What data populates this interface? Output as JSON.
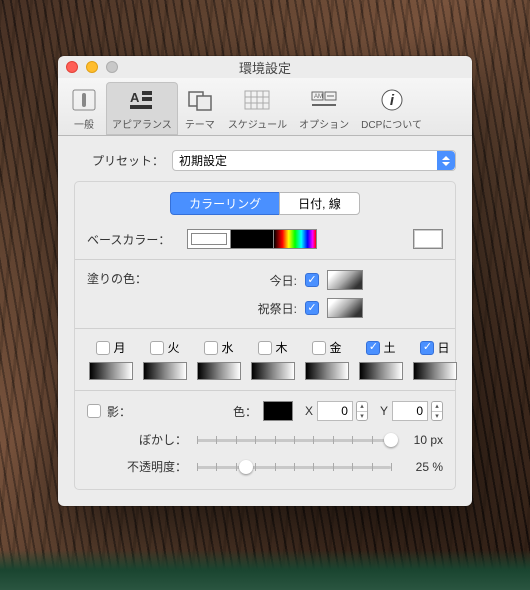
{
  "window": {
    "title": "環境設定"
  },
  "toolbar": {
    "items": [
      {
        "label": "一般"
      },
      {
        "label": "アピアランス"
      },
      {
        "label": "テーマ"
      },
      {
        "label": "スケジュール"
      },
      {
        "label": "オプション"
      },
      {
        "label": "DCPについて"
      }
    ],
    "active_index": 1
  },
  "preset": {
    "label": "プリセット：",
    "value": "初期設定"
  },
  "tabs": {
    "coloring": "カラーリング",
    "date_lines": "日付, 線",
    "active": "coloring"
  },
  "base_color": {
    "label": "ベースカラー："
  },
  "fill": {
    "label": "塗りの色：",
    "today": {
      "label": "今日:",
      "checked": true
    },
    "holiday": {
      "label": "祝祭日:",
      "checked": true
    }
  },
  "days": {
    "mon": {
      "label": "月",
      "checked": false
    },
    "tue": {
      "label": "火",
      "checked": false
    },
    "wed": {
      "label": "水",
      "checked": false
    },
    "thu": {
      "label": "木",
      "checked": false
    },
    "fri": {
      "label": "金",
      "checked": false
    },
    "sat": {
      "label": "土",
      "checked": true
    },
    "sun": {
      "label": "日",
      "checked": true
    }
  },
  "shadow": {
    "label": "影：",
    "checked": false,
    "color_label": "色：",
    "x_label": "X",
    "x_value": "0",
    "y_label": "Y",
    "y_value": "0",
    "blur_label": "ぼかし：",
    "blur_value": "10 px",
    "blur_percent": 100,
    "opacity_label": "不透明度：",
    "opacity_value": "25 %",
    "opacity_percent": 25
  }
}
